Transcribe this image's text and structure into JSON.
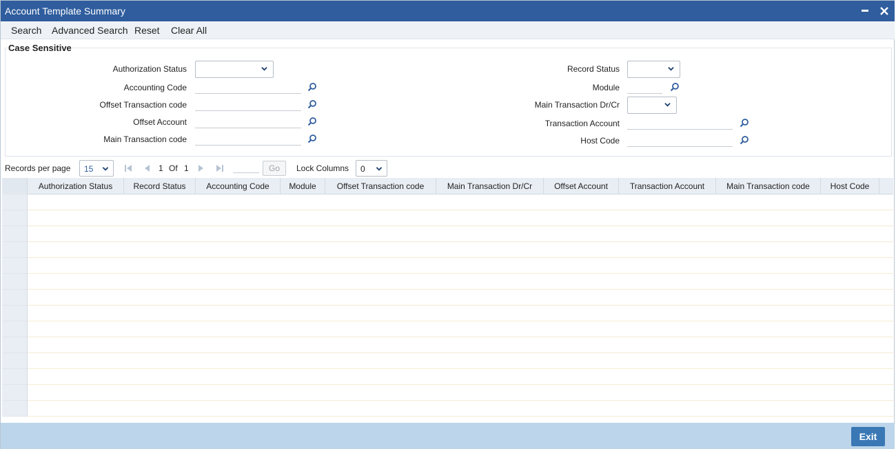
{
  "window": {
    "title": "Account Template Summary"
  },
  "toolbar": {
    "search": "Search",
    "advanced_search": "Advanced Search",
    "reset": "Reset",
    "clear_all": "Clear All"
  },
  "criteria": {
    "legend": "Case Sensitive",
    "left": {
      "authorization_status": "Authorization Status",
      "accounting_code": "Accounting Code",
      "offset_transaction_code": "Offset Transaction code",
      "offset_account": "Offset Account",
      "main_transaction_code": "Main Transaction code"
    },
    "right": {
      "record_status": "Record Status",
      "module": "Module",
      "main_transaction_drcr": "Main Transaction Dr/Cr",
      "transaction_account": "Transaction Account",
      "host_code": "Host Code"
    }
  },
  "pager": {
    "records_per_page_label": "Records per page",
    "records_per_page_value": "15",
    "current_page": "1",
    "of_label": "Of",
    "total_pages": "1",
    "go_label": "Go",
    "lock_columns_label": "Lock Columns",
    "lock_columns_value": "0"
  },
  "grid": {
    "columns": [
      "Authorization Status",
      "Record Status",
      "Accounting Code",
      "Module",
      "Offset Transaction code",
      "Main Transaction Dr/Cr",
      "Offset Account",
      "Transaction Account",
      "Main Transaction code",
      "Host Code"
    ]
  },
  "footer": {
    "exit_label": "Exit"
  },
  "colors": {
    "titlebar": "#2f5d9e",
    "footer": "#bcd5ea",
    "exit_button": "#3a78b5"
  }
}
